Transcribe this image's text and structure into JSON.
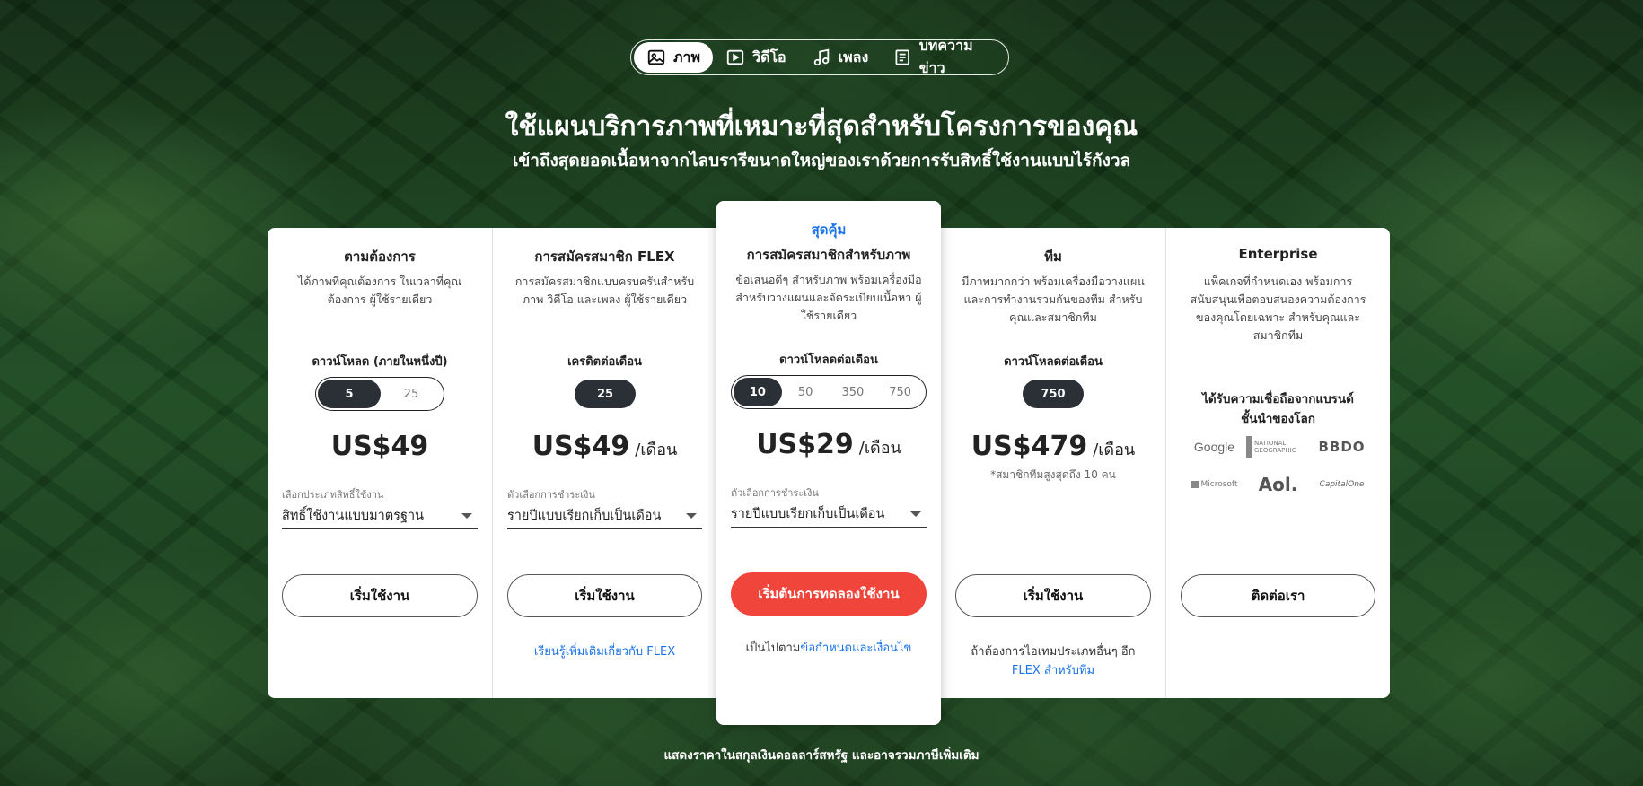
{
  "tabs": [
    {
      "label": "ภาพ",
      "icon": "image-icon"
    },
    {
      "label": "วิดีโอ",
      "icon": "video-icon"
    },
    {
      "label": "เพลง",
      "icon": "music-icon"
    },
    {
      "label": "บทความข่าว",
      "icon": "article-icon"
    }
  ],
  "hero": {
    "title": "ใช้แผนบริการภาพที่เหมาะที่สุดสำหรับโครงการของคุณ",
    "subtitle": "เข้าถึงสุดยอดเนื้อหาจากไลบรารีขนาดใหญ่ของเราด้วยการรับสิทธิ์ใช้งานแบบไร้กังวล"
  },
  "plans": [
    {
      "name": "ตามต้องการ",
      "desc": "ได้ภาพที่คุณต้องการ ในเวลาที่คุณต้องการ ผู้ใช้รายเดียว",
      "meter_label": "ดาวน์โหลด (ภายในหนึ่งปี)",
      "options": [
        "5",
        "25"
      ],
      "selected": "5",
      "price": "US$49",
      "per": "",
      "select_label": "เลือกประเภทสิทธิ์ใช้งาน",
      "select_value": "สิทธิ์ใช้งานแบบมาตรฐาน",
      "button": "เริ่มใช้งาน"
    },
    {
      "name": "การสมัครสมาชิก FLEX",
      "desc": "การสมัครสมาชิกแบบครบครันสำหรับภาพ วิดีโอ และเพลง ผู้ใช้รายเดียว",
      "meter_label": "เครดิตต่อเดือน",
      "options": [
        "25"
      ],
      "selected": "25",
      "price": "US$49",
      "per": "/เดือน",
      "select_label": "ตัวเลือกการชำระเงิน",
      "select_value": "รายปีแบบเรียกเก็บเป็นเดือน",
      "button": "เริ่มใช้งาน",
      "foot_link": "เรียนรู้เพิ่มเติมเกี่ยวกับ FLEX"
    },
    {
      "badge": "สุดคุ้ม",
      "name": "การสมัครสมาชิกสำหรับภาพ",
      "desc": "ข้อเสนอดีๆ สำหรับภาพ พร้อมเครื่องมือสำหรับวางแผนและจัดระเบียบเนื้อหา ผู้ใช้รายเดียว",
      "meter_label": "ดาวน์โหลดต่อเดือน",
      "options": [
        "10",
        "50",
        "350",
        "750"
      ],
      "selected": "10",
      "price": "US$29",
      "per": "/เดือน",
      "select_label": "ตัวเลือกการชำระเงิน",
      "select_value": "รายปีแบบเรียกเก็บเป็นเดือน",
      "button": "เริ่มต้นการทดลองใช้งาน",
      "foot_prefix": "เป็นไปตาม",
      "foot_link": "ข้อกำหนดและเงื่อนไข"
    },
    {
      "name": "ทีม",
      "desc": "มีภาพมากกว่า พร้อมเครื่องมือวางแผนและการทำงานร่วมกันของทีม สำหรับคุณและสมาชิกทีม",
      "meter_label": "ดาวน์โหลดต่อเดือน",
      "options": [
        "750"
      ],
      "selected": "750",
      "price": "US$479",
      "per": "/เดือน",
      "price_note": "*สมาชิกทีมสูงสุดถึง 10 คน",
      "button": "เริ่มใช้งาน",
      "foot_prefix": "ถ้าต้องการไอเทมประเภทอื่นๆ อีก",
      "foot_link": "FLEX สำหรับทีม"
    },
    {
      "name": "Enterprise",
      "desc": "แพ็คเกจที่กำหนดเอง พร้อมการสนับสนุนเพื่อตอบสนองความต้องการของคุณโดยเฉพาะ สำหรับคุณและสมาชิกทีม",
      "trusted": "ได้รับความเชื่อถือจากแบรนด์ชั้นนำของโลก",
      "brands": [
        "Google",
        "NATIONAL GEOGRAPHIC",
        "BBDO",
        "Microsoft",
        "Aol.",
        "CapitalOne"
      ],
      "button": "ติดต่อเรา"
    }
  ],
  "disclaimer": "แสดงราคาในสกุลเงินดอลลาร์สหรัฐ และอาจรวมภาษีเพิ่มเติม"
}
